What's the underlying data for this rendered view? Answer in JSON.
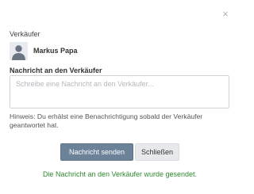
{
  "dialog": {
    "close_glyph": "×"
  },
  "seller": {
    "label": "Verkäufer",
    "name": "Markus Papa",
    "avatar_icon": "user-avatar-icon"
  },
  "message": {
    "label": "Nachricht an den Verkäufer",
    "placeholder": "Schreibe eine Nachricht an den Verkäufer...",
    "value": "",
    "hint": "Hinweis: Du erhälst eine Benachrichtigung sobald der Verkäufer geantwortet hat."
  },
  "actions": {
    "send_label": "Nachricht senden",
    "close_label": "Schließen"
  },
  "status": {
    "success_text": "Die Nachricht an den Verkäufer wurde gesendet.",
    "success_color": "#2e8b2e"
  },
  "colors": {
    "primary_button": "#6c8299",
    "secondary_button": "#e7e9ec"
  }
}
